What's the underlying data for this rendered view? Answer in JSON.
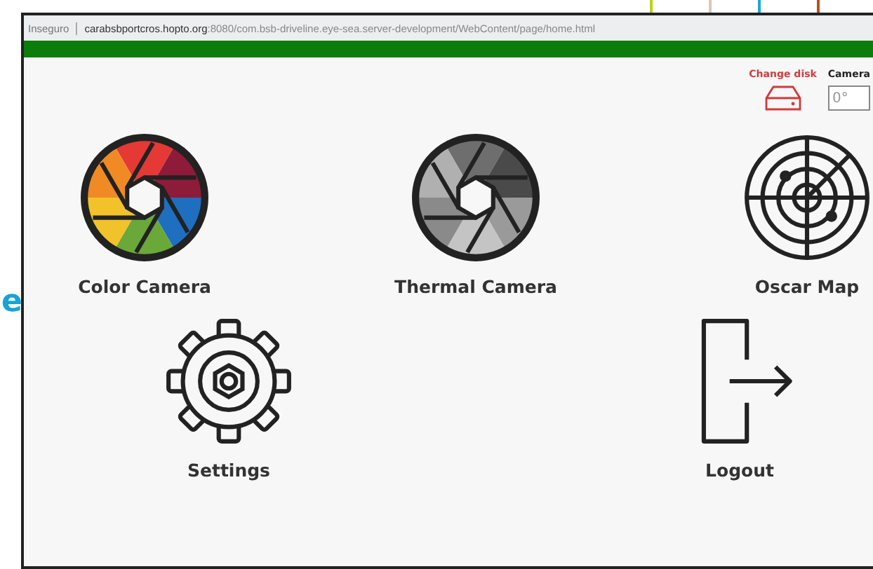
{
  "backdrop_text": "e",
  "browser": {
    "security_label": "Inseguro",
    "url_host": "carabsbportcros.hopto.org",
    "url_rest": ":8080/com.bsb-driveline.eye-sea.server-development/WebContent/page/home.html"
  },
  "toolbar": {
    "change_disk_label": "Change disk",
    "camera_label": "Camera",
    "camera_value": "0°"
  },
  "menu_rows": [
    [
      {
        "label": "Color Camera",
        "kind": "color-aperture"
      },
      {
        "label": "Thermal Camera",
        "kind": "grey-aperture"
      },
      {
        "label": "Oscar Map",
        "kind": "radar"
      }
    ],
    [
      {
        "label": "Settings",
        "kind": "gear"
      },
      {
        "label": "Logout",
        "kind": "logout"
      }
    ]
  ]
}
